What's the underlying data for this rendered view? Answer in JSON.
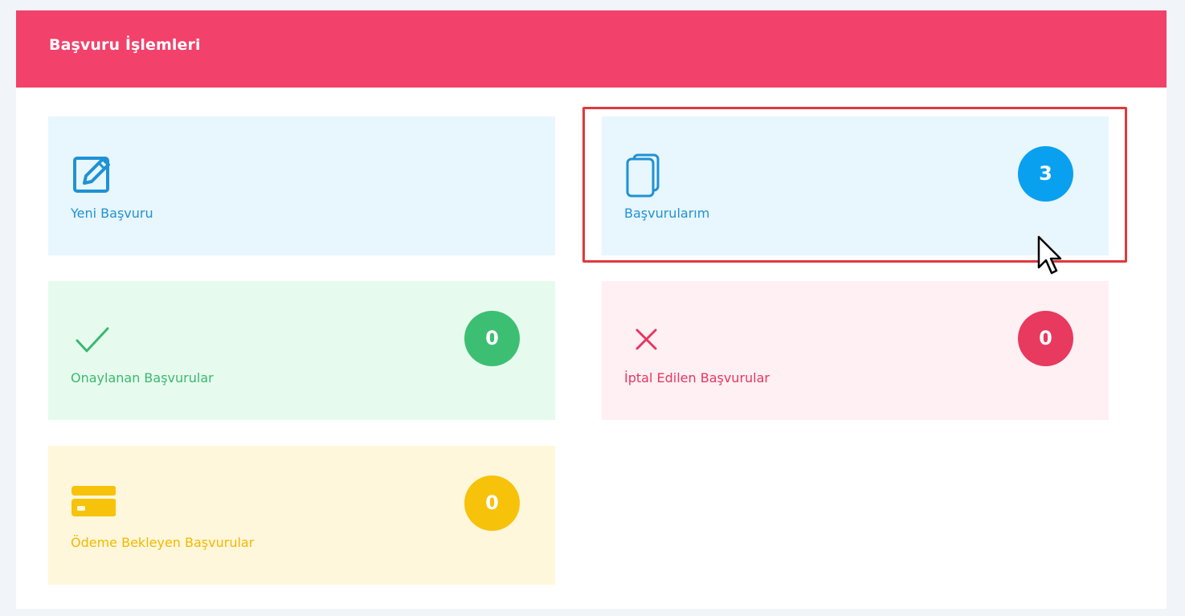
{
  "panel": {
    "title": "Başvuru İşlemleri",
    "header_color": "#f2416b"
  },
  "cards": [
    {
      "id": "new",
      "label": "Yeni Başvuru",
      "icon": "edit-icon",
      "color": "#1f92d4",
      "badge": null
    },
    {
      "id": "mine",
      "label": "Başvurularım",
      "icon": "copy-icon",
      "color": "#1f92d4",
      "badge": "3",
      "badge_color": "#0aa0f0",
      "highlighted": true
    },
    {
      "id": "approved",
      "label": "Onaylanan Başvurular",
      "icon": "check-icon",
      "color": "#3cb770",
      "badge": "0",
      "badge_color": "#3cbf72"
    },
    {
      "id": "cancelled",
      "label": "İptal Edilen Başvurular",
      "icon": "x-icon",
      "color": "#e5375f",
      "badge": "0",
      "badge_color": "#e8395f"
    },
    {
      "id": "pending_payment",
      "label": "Ödeme Bekleyen Başvurular",
      "icon": "credit-card-icon",
      "color": "#f3b800",
      "badge": "0",
      "badge_color": "#f7c20a"
    }
  ],
  "annotation": {
    "highlight_color": "#e0393d"
  }
}
